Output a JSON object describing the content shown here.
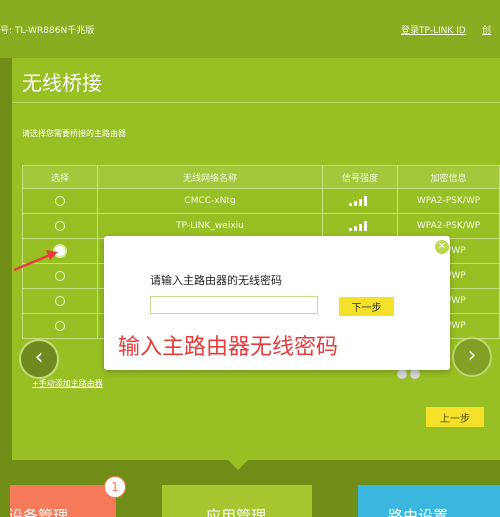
{
  "header": {
    "model": "号: TL-WR886N千兆版",
    "login_link": "登录TP-LINK ID",
    "login_link2": "创"
  },
  "page": {
    "title": "无线桥接",
    "subtitle": "请选择您需要桥接的主路由器"
  },
  "table": {
    "headers": [
      "选择",
      "无线网络名称",
      "信号强度",
      "加密信息"
    ],
    "rows": [
      {
        "ssid": "CMCC-xNtg",
        "encryption": "WPA2-PSK/WP",
        "selected": false
      },
      {
        "ssid": "TP-LINK_weixiu",
        "encryption": "WPA2-PSK/WP",
        "selected": false
      },
      {
        "ssid": "",
        "encryption": "PSK/WP",
        "selected": true
      },
      {
        "ssid": "",
        "encryption": "PSK/WP",
        "selected": false
      },
      {
        "ssid": "",
        "encryption": "PSK/WP",
        "selected": false
      },
      {
        "ssid": "",
        "encryption": "PSK/WP",
        "selected": false
      }
    ]
  },
  "links": {
    "add_router": "+手动添加主路由器"
  },
  "buttons": {
    "prev": "上一步"
  },
  "modal": {
    "label": "请输入主路由器的无线密码",
    "input_value": "",
    "next_button": "下一步",
    "close_icon": "close-icon",
    "annotation": "输入主路由器无线密码"
  },
  "bottom_cards": [
    {
      "label": "设备管理",
      "color": "#f6795a"
    },
    {
      "label": "应用管理",
      "color": "#a5c62e"
    },
    {
      "label": "路由设置",
      "color": "#3bb7df"
    }
  ],
  "badge": "1",
  "nav": {
    "left_icon": "chevron-left-icon",
    "right_icon": "chevron-right-icon"
  },
  "colors": {
    "accent": "#98bf24",
    "button": "#f5e12a",
    "annotation": "#e83c3c"
  }
}
